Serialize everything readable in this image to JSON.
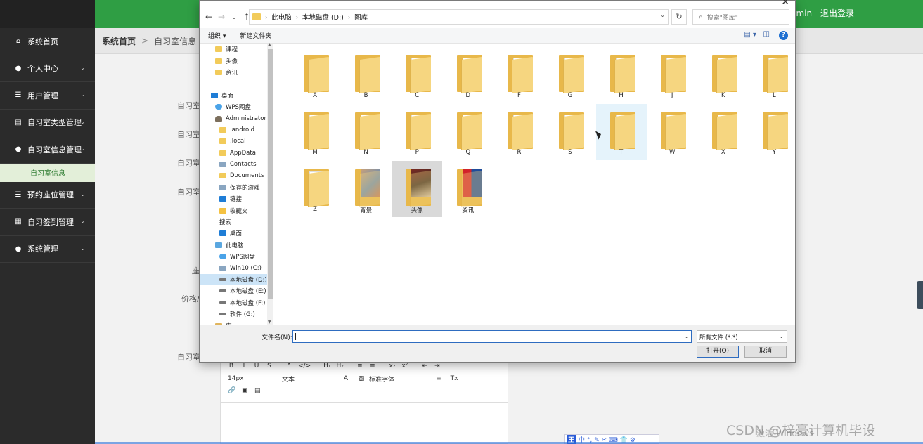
{
  "app": {
    "top_user": "admin",
    "logout": "退出登录",
    "breadcrumb": [
      "系统首页",
      "自习室信息"
    ],
    "sidebar": [
      {
        "label": "系统首页",
        "icon": "home-icon"
      },
      {
        "label": "个人中心",
        "icon": "user-icon"
      },
      {
        "label": "用户管理",
        "icon": "list-icon"
      },
      {
        "label": "自习室类型管理",
        "icon": "clipboard-icon"
      },
      {
        "label": "自习室信息管理",
        "icon": "user-icon"
      },
      {
        "label": "自习室信息",
        "sub": true
      },
      {
        "label": "预约座位管理",
        "icon": "list-icon"
      },
      {
        "label": "自习签到管理",
        "icon": "grid-icon"
      },
      {
        "label": "系统管理",
        "icon": "bulb-icon"
      }
    ],
    "form_labels": [
      "自习室",
      "自习室",
      "自习室",
      "自习室",
      "座",
      "价格/",
      "自习室"
    ],
    "editor": {
      "row1": [
        "B",
        "I",
        "U",
        "S",
        "❞",
        "</>",
        "H₁",
        "H₂",
        "≡",
        "≡",
        "x₂",
        "x²",
        "⇤",
        "⇥"
      ],
      "row2": [
        "14px",
        "文本",
        "标准字体"
      ],
      "row3": [
        "🔗",
        "▣",
        "▤"
      ]
    },
    "watermark": "CSDN @梓豪计算机毕设",
    "watermark2": "激活 Windows"
  },
  "dialog": {
    "close": "✕",
    "address": [
      "此电脑",
      "本地磁盘 (D:)",
      "图库"
    ],
    "search_placeholder": "搜索\"图库\"",
    "toolbar": {
      "organize": "组织 ▾",
      "new_folder": "新建文件夹",
      "help": "?"
    },
    "nav_items": [
      {
        "label": "课程",
        "icon": "folder",
        "indent": 22
      },
      {
        "label": "头像",
        "icon": "folder",
        "indent": 22
      },
      {
        "label": "资讯",
        "icon": "folder",
        "indent": 22
      },
      {
        "label": "",
        "icon": "",
        "indent": 0
      },
      {
        "label": "桌面",
        "icon": "blue",
        "indent": 16
      },
      {
        "label": "WPS网盘",
        "icon": "cloud",
        "indent": 22
      },
      {
        "label": "Administrator",
        "icon": "user",
        "indent": 22
      },
      {
        "label": ".android",
        "icon": "folder",
        "indent": 28
      },
      {
        "label": ".local",
        "icon": "folder",
        "indent": 28
      },
      {
        "label": "AppData",
        "icon": "folder",
        "indent": 28
      },
      {
        "label": "Contacts",
        "icon": "gray",
        "indent": 28
      },
      {
        "label": "Documents",
        "icon": "folder",
        "indent": 28
      },
      {
        "label": "保存的游戏",
        "icon": "gray",
        "indent": 28
      },
      {
        "label": "链接",
        "icon": "blue",
        "indent": 28
      },
      {
        "label": "收藏夹",
        "icon": "star",
        "indent": 28
      },
      {
        "label": "搜索",
        "icon": "search",
        "indent": 28
      },
      {
        "label": "桌面",
        "icon": "blue",
        "indent": 28
      },
      {
        "label": "此电脑",
        "icon": "pc",
        "indent": 22
      },
      {
        "label": "WPS网盘",
        "icon": "cloud",
        "indent": 28
      },
      {
        "label": "Win10 (C:)",
        "icon": "gray",
        "indent": 28
      },
      {
        "label": "本地磁盘 (D:)",
        "icon": "drive",
        "indent": 28,
        "selected": true
      },
      {
        "label": "本地磁盘 (E:)",
        "icon": "drive",
        "indent": 28
      },
      {
        "label": "本地磁盘 (F:)",
        "icon": "drive",
        "indent": 28
      },
      {
        "label": "软件 (G:)",
        "icon": "drive",
        "indent": 28
      },
      {
        "label": "库",
        "icon": "lib",
        "indent": 22
      }
    ],
    "files": [
      {
        "name": "A",
        "type": "empty"
      },
      {
        "name": "B",
        "type": "empty"
      },
      {
        "name": "C",
        "type": "doc"
      },
      {
        "name": "D",
        "type": "doc"
      },
      {
        "name": "F",
        "type": "doc"
      },
      {
        "name": "G",
        "type": "doc"
      },
      {
        "name": "H",
        "type": "doc"
      },
      {
        "name": "J",
        "type": "doc"
      },
      {
        "name": "K",
        "type": "doc"
      },
      {
        "name": "L",
        "type": "doc"
      },
      {
        "name": "M",
        "type": "doc"
      },
      {
        "name": "N",
        "type": "doc"
      },
      {
        "name": "P",
        "type": "doc"
      },
      {
        "name": "Q",
        "type": "doc"
      },
      {
        "name": "R",
        "type": "doc"
      },
      {
        "name": "S",
        "type": "doc"
      },
      {
        "name": "T",
        "type": "doc",
        "hover": true
      },
      {
        "name": "W",
        "type": "doc"
      },
      {
        "name": "X",
        "type": "doc"
      },
      {
        "name": "Y",
        "type": "doc"
      },
      {
        "name": "Z",
        "type": "doc"
      },
      {
        "name": "背景",
        "type": "pic-bg"
      },
      {
        "name": "头像",
        "type": "pic-head",
        "selected": true
      },
      {
        "name": "资讯",
        "type": "pic-news"
      }
    ],
    "filename_label": "文件名(N):",
    "filename_value": "",
    "filter": "所有文件 (*.*)",
    "open_button": "打开(O)",
    "cancel_button": "取消"
  },
  "ime": {
    "key": "王",
    "items": "中 °, ✎ ✂ ⌨ 👕 ⚙"
  }
}
